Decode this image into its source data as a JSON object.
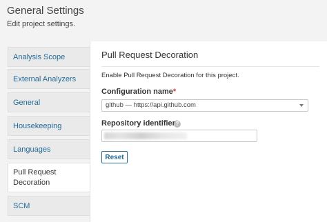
{
  "header": {
    "title": "General Settings",
    "subtitle": "Edit project settings."
  },
  "sidebar": {
    "items": [
      {
        "label": "Analysis Scope"
      },
      {
        "label": "External Analyzers"
      },
      {
        "label": "General"
      },
      {
        "label": "Housekeeping"
      },
      {
        "label": "Languages"
      },
      {
        "label": "Pull Request Decoration",
        "active": true
      },
      {
        "label": "SCM"
      }
    ]
  },
  "main": {
    "section_title": "Pull Request Decoration",
    "description": "Enable Pull Request Decoration for this project.",
    "config_label": "Configuration name",
    "config_value": "github — https://api.github.com",
    "repo_label": "Repository identifier",
    "required_mark": "*",
    "help_glyph": "?",
    "repo_value": "",
    "reset_label": "Reset"
  },
  "colors": {
    "link": "#236a97",
    "required": "#d4333f",
    "background": "#f3f3f3"
  }
}
